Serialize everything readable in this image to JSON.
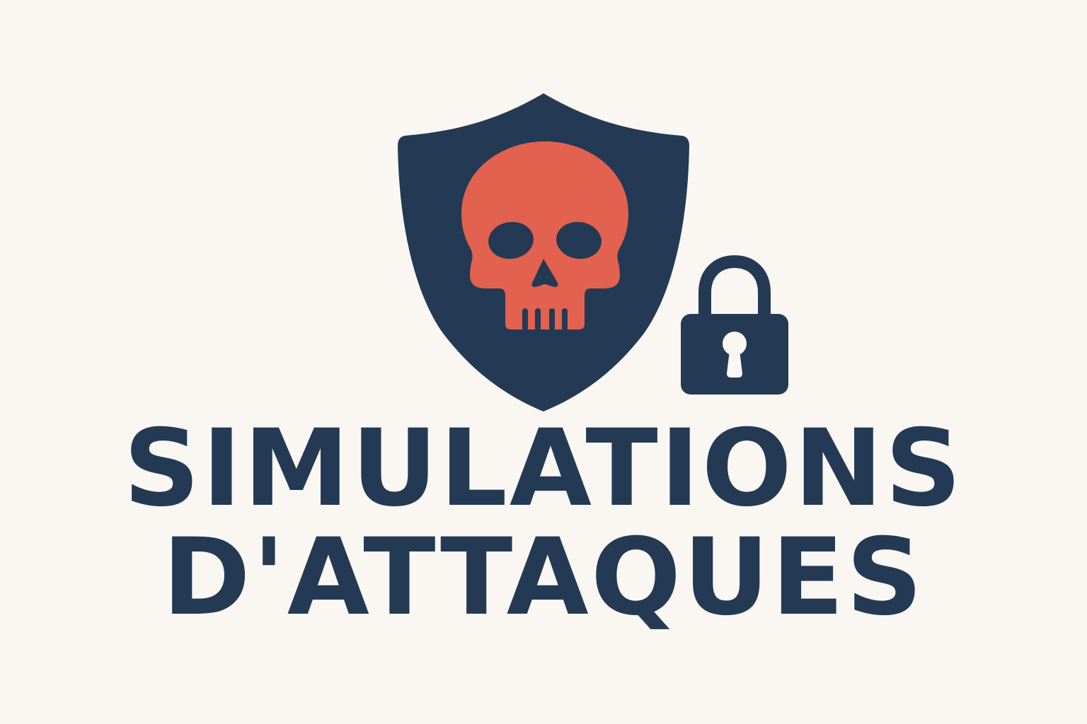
{
  "title": {
    "line1": "SIMULATIONS",
    "line2": "D'ATTAQUES"
  },
  "icons": {
    "shield": "shield-icon",
    "skull": "skull-icon",
    "padlock": "padlock-icon"
  },
  "colors": {
    "background": "#faf7f3",
    "navy": "#243a54",
    "coral": "#e2614f"
  }
}
